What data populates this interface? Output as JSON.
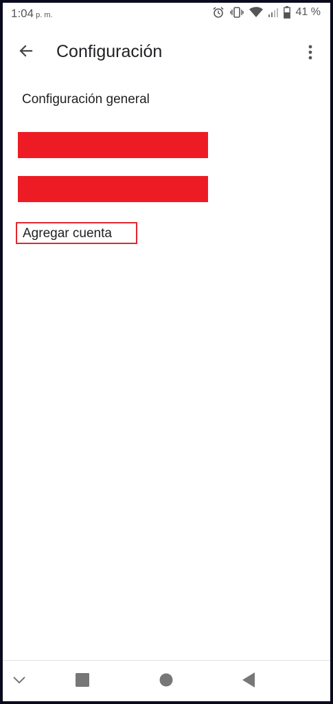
{
  "status_bar": {
    "time": "1:04",
    "ampm": "p. m.",
    "battery_percent": "41 %",
    "icons": [
      "alarm-icon",
      "vibrate-icon",
      "wifi-icon",
      "signal-icon",
      "battery-icon"
    ]
  },
  "app_bar": {
    "title": "Configuración",
    "back_icon": "arrow-back-icon",
    "menu_icon": "more-vert-icon"
  },
  "settings": {
    "general_label": "Configuración general",
    "add_account_label": "Agregar cuenta",
    "redaction_color": "#ed1c24",
    "highlight_color": "#e0262e"
  },
  "nav_bar": {
    "icons": [
      "chevron-down-icon",
      "recents-square-icon",
      "home-circle-icon",
      "back-triangle-icon"
    ]
  }
}
